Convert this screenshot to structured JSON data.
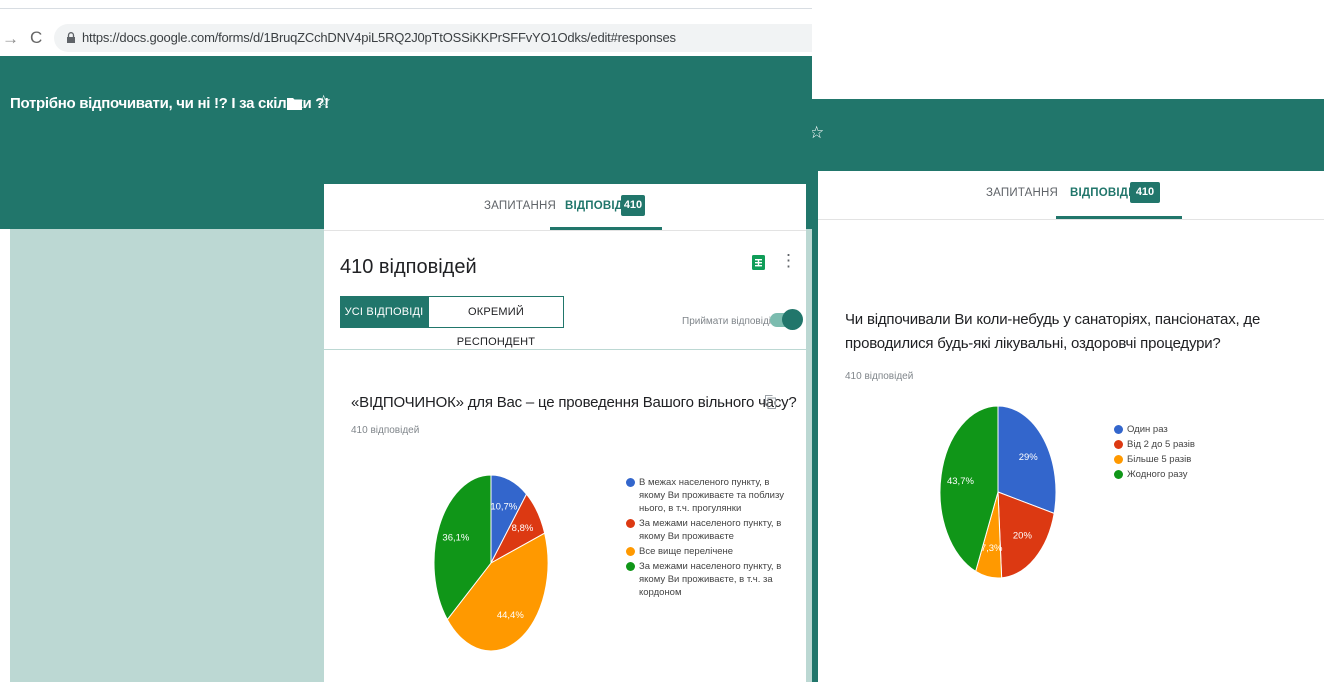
{
  "browser": {
    "url": "https://docs.google.com/forms/d/1BruqZCchDNV4piL5RQ2J0pTtOSSiKKPrSFFvYO1Odks/edit#responses"
  },
  "form": {
    "title": "Потрібно відпочивати, чи ні !? І за скільки ?!"
  },
  "tabs": {
    "questions": "ЗАПИТАННЯ",
    "responses": "ВІДПОВІДІ",
    "responses_count": "410"
  },
  "summary": {
    "count_label": "410 відповідей",
    "all_responses": "УСІ ВІДПОВІДІ",
    "individual": "ОКРЕМИЙ РЕСПОНДЕНТ",
    "accepting": "Приймати відповіді"
  },
  "colors": {
    "accent": "#21766b",
    "blue": "#3366cc",
    "red": "#dc3912",
    "orange": "#ff9900",
    "green": "#109618"
  },
  "question1": {
    "title": "«ВІДПОЧИНОК» для Вас – це проведення Вашого вільного часу?",
    "count": "410 відповідей",
    "chart_data": {
      "type": "pie",
      "slices": [
        {
          "label": "В межах населеного пункту, в якому Ви проживаєте та поблизу нього, в т.ч. прогулянки",
          "value": 10.7,
          "display": "10,7%",
          "color": "#3366cc"
        },
        {
          "label": "За межами населеного пункту, в якому Ви проживаєте",
          "value": 8.8,
          "display": "8,8%",
          "color": "#dc3912"
        },
        {
          "label": "Все вище перелічене",
          "value": 44.4,
          "display": "44,4%",
          "color": "#ff9900"
        },
        {
          "label": "За межами населеного пункту, в якому Ви проживаєте, в т.ч. за кордоном",
          "value": 36.1,
          "display": "36,1%",
          "color": "#109618"
        }
      ]
    }
  },
  "question2": {
    "title": "Чи відпочивали Ви коли-небудь у санаторіях, пансіонатах, де проводилися будь-які лікувальні, оздоровчі процедури?",
    "count": "410 відповідей",
    "chart_data": {
      "type": "pie",
      "slices": [
        {
          "label": "Один раз",
          "value": 29,
          "display": "29%",
          "color": "#3366cc"
        },
        {
          "label": "Від 2 до 5 разів",
          "value": 20,
          "display": "20%",
          "color": "#dc3912"
        },
        {
          "label": "Більше 5 разів",
          "value": 7.3,
          "display": "7,3%",
          "color": "#ff9900"
        },
        {
          "label": "Жодного разу",
          "value": 43.7,
          "display": "43,7%",
          "color": "#109618"
        }
      ]
    }
  }
}
